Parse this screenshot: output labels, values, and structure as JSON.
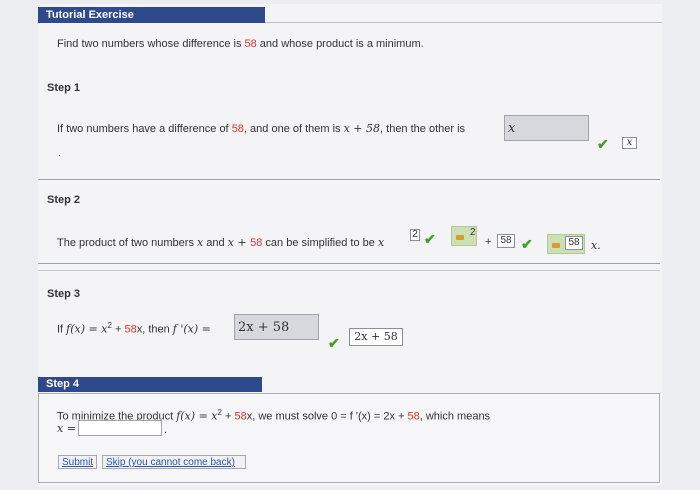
{
  "header": {
    "title": "Tutorial Exercise"
  },
  "problem": {
    "prefix": "Find two numbers whose difference is ",
    "value": "58",
    "suffix": " and whose product is a minimum."
  },
  "step1": {
    "label": "Step 1",
    "text_a": "If two numbers have a difference of ",
    "value_a": "58",
    "text_b": ", and one of them is ",
    "expr": "x + 58",
    "text_c": ", then the other is ",
    "answer": "x",
    "hint_box": "x"
  },
  "step2": {
    "label": "Step 2",
    "text_a": "The product of two numbers ",
    "x1": "x",
    "text_b": " and ",
    "expr": "x + ",
    "value": "58",
    "text_c": " can be simplified to be ",
    "x2": "x",
    "exp_box": "2",
    "plus": "+",
    "coef_box": "58",
    "coef_hint": "58",
    "x3": "x.",
    "key_hint": "2"
  },
  "step3": {
    "label": "Step 3",
    "text_a": "If ",
    "fx": "f(x) = x",
    "sup": "2",
    "text_b": " + ",
    "value": "58",
    "text_c": "x, then ",
    "fpx": "f '(x) = ",
    "answer": "2x + 58",
    "hint": "2x + 58"
  },
  "step4": {
    "label": "Step 4",
    "text_a": "To minimize the product ",
    "fx": "f(x) = x",
    "sup": "2",
    "text_b": " + ",
    "value": "58",
    "text_c": "x, we must solve 0 = f '(x) = 2x + ",
    "value2": "58",
    "text_d": ", which means",
    "x_label": "x =",
    "period": ".",
    "submit": "Submit",
    "skip": "Skip (you cannot come back)"
  },
  "colors": {
    "accent": "#2e4a8a",
    "highlight": "#d9342b",
    "check": "#4a9a2e"
  },
  "icons": [
    "checkmark-icon",
    "key-hint-icon"
  ]
}
